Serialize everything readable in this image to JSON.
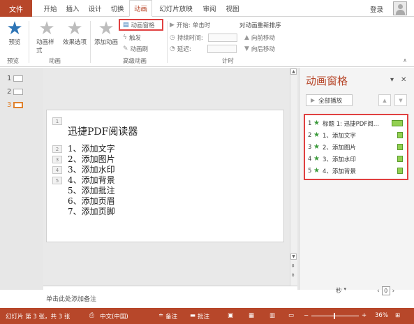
{
  "tabs": {
    "file": "文件",
    "items": [
      "开始",
      "插入",
      "设计",
      "切换",
      "动画",
      "幻灯片放映",
      "审阅",
      "视图"
    ],
    "active": "动画",
    "login": "登录"
  },
  "ribbon": {
    "preview": "预览",
    "group_preview": "预览",
    "anim_style": "动画样式",
    "effect_options": "效果选项",
    "group_anim": "动画",
    "add_anim": "添加动画",
    "anim_pane_btn": "动画窗格",
    "trigger": "触发",
    "anim_painter": "动画刷",
    "group_adv": "高级动画",
    "start_label": "开始:",
    "start_value": "单击时",
    "duration_label": "持续时间:",
    "delay_label": "延迟:",
    "reorder": "对动画重新排序",
    "move_earlier": "向前移动",
    "move_later": "向后移动",
    "group_timing": "计时"
  },
  "thumbnails": [
    "1",
    "2",
    "3"
  ],
  "slide": {
    "title_num": "1",
    "title": "迅捷PDF阅读器",
    "items": [
      {
        "num": "2",
        "text": "1、添加文字"
      },
      {
        "num": "3",
        "text": "2、添加图片"
      },
      {
        "num": "4",
        "text": "3、添加水印"
      },
      {
        "num": "5",
        "text": "4、添加背景"
      },
      {
        "num": "",
        "text": "5、添加批注"
      },
      {
        "num": "",
        "text": "6、添加页眉"
      },
      {
        "num": "",
        "text": "7、添加页脚"
      }
    ]
  },
  "pane": {
    "title": "动画窗格",
    "play_all": "全部播放",
    "rows": [
      {
        "n": "1",
        "text": "标题 1: 迅捷PDF阅..."
      },
      {
        "n": "2",
        "text": "1、添加文字"
      },
      {
        "n": "3",
        "text": "2、添加图片"
      },
      {
        "n": "4",
        "text": "3、添加水印"
      },
      {
        "n": "5",
        "text": "4、添加背景"
      }
    ],
    "seconds": "秒",
    "page": "0"
  },
  "notes": {
    "placeholder": "单击此处添加备注"
  },
  "status": {
    "slide_info": "幻灯片 第 3 张，共 3 张",
    "language": "中文(中国)",
    "notes": "备注",
    "comments": "批注",
    "zoom": "36%"
  },
  "colors": {
    "accent": "#b7472a",
    "highlight": "#e04040",
    "anim_bar": "#92d050"
  }
}
